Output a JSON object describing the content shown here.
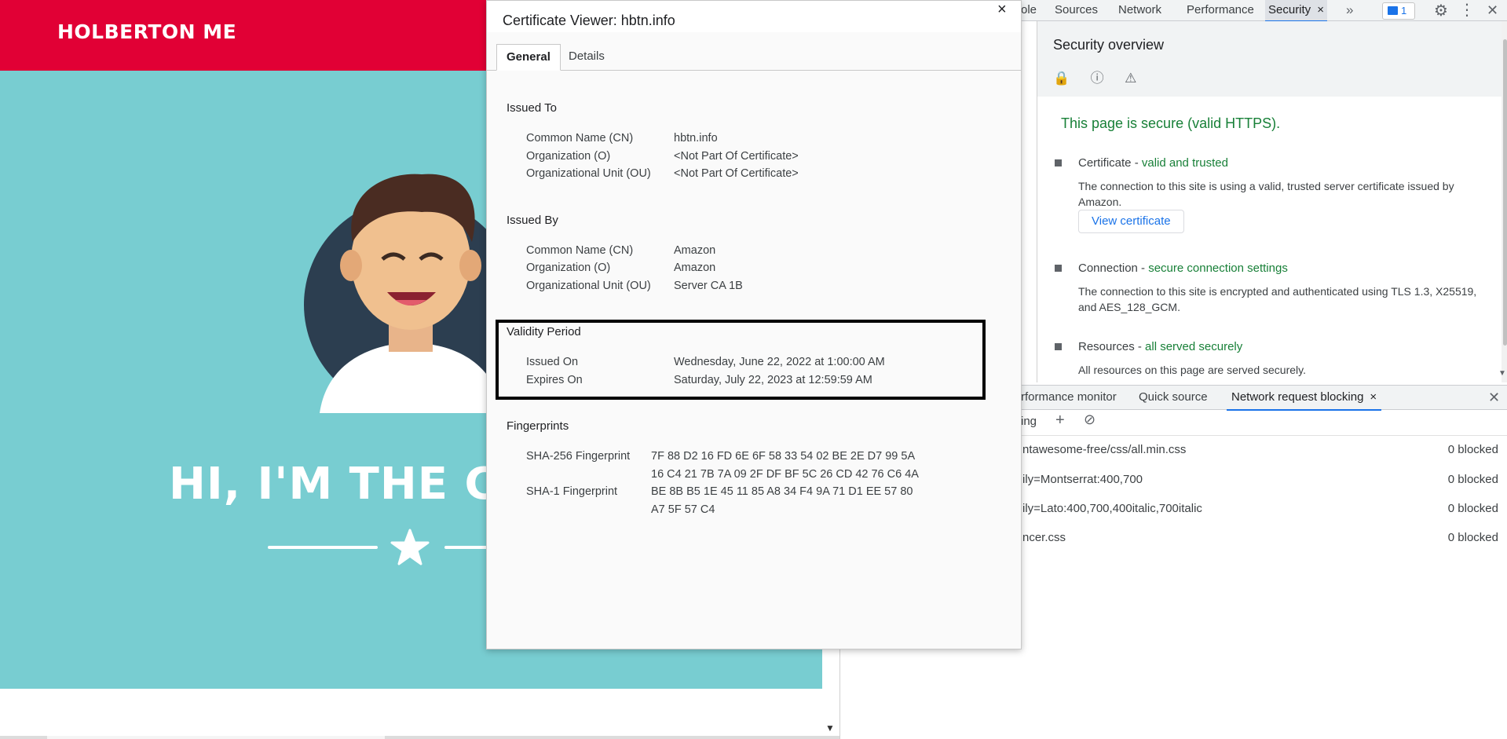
{
  "site": {
    "title": "HOLBERTON ME",
    "hero_heading": "HI, I'M THE CH"
  },
  "colors": {
    "header_bg": "#e10035",
    "hero_bg": "#78cdd1",
    "secure_green": "#188038",
    "link_blue": "#1a73e8"
  },
  "devtools": {
    "tabs": [
      {
        "label": "ole"
      },
      {
        "label": "Sources"
      },
      {
        "label": "Network"
      },
      {
        "label": "Performance"
      },
      {
        "label": "Security"
      }
    ],
    "close_tab_glyph": "×",
    "more_glyph": "»",
    "issues_count": "1",
    "security": {
      "title": "Security overview",
      "secure_message": "This page is secure (valid HTTPS).",
      "items": [
        {
          "label": "Certificate - ",
          "status": "valid and trusted",
          "description": "The connection to this site is using a valid, trusted server certificate issued by Amazon.",
          "button": "View certificate"
        },
        {
          "label": "Connection - ",
          "status": "secure connection settings",
          "description": "The connection to this site is encrypted and authenticated using TLS 1.3, X25519, and AES_128_GCM."
        },
        {
          "label": "Resources - ",
          "status": "all served securely",
          "description": "All resources on this page are served securely."
        }
      ]
    },
    "drawer": {
      "tabs": [
        {
          "label": "rformance monitor"
        },
        {
          "label": "Quick source"
        },
        {
          "label": "Network request blocking"
        }
      ],
      "toolbar_text": "ing",
      "rows": [
        {
          "pattern": "ntawesome-free/css/all.min.css",
          "count": "0 blocked"
        },
        {
          "pattern": "ily=Montserrat:400,700",
          "count": "0 blocked"
        },
        {
          "pattern": "ily=Lato:400,700,400italic,700italic",
          "count": "0 blocked"
        },
        {
          "pattern": "ncer.css",
          "count": "0 blocked"
        }
      ]
    }
  },
  "cert": {
    "title": "Certificate Viewer: hbtn.info",
    "close_glyph": "×",
    "tabs": {
      "general": "General",
      "details": "Details"
    },
    "issued_to": {
      "heading": "Issued To",
      "rows": [
        {
          "k": "Common Name (CN)",
          "v": "hbtn.info"
        },
        {
          "k": "Organization (O)",
          "v": "<Not Part Of Certificate>"
        },
        {
          "k": "Organizational Unit (OU)",
          "v": "<Not Part Of Certificate>"
        }
      ]
    },
    "issued_by": {
      "heading": "Issued By",
      "rows": [
        {
          "k": "Common Name (CN)",
          "v": "Amazon"
        },
        {
          "k": "Organization (O)",
          "v": "Amazon"
        },
        {
          "k": "Organizational Unit (OU)",
          "v": "Server CA 1B"
        }
      ]
    },
    "validity": {
      "heading": "Validity Period",
      "rows": [
        {
          "k": "Issued On",
          "v": "Wednesday, June 22, 2022 at 1:00:00 AM"
        },
        {
          "k": "Expires On",
          "v": "Saturday, July 22, 2023 at 12:59:59 AM"
        }
      ]
    },
    "fingerprints": {
      "heading": "Fingerprints",
      "sha256_label": "SHA-256 Fingerprint",
      "sha256_line1": "7F 88 D2 16 FD 6E 6F 58 33 54 02 BE 2E D7 99 5A",
      "sha256_line2": "16 C4 21 7B 7A 09 2F DF BF 5C 26 CD 42 76 C6 4A",
      "sha1_label": "SHA-1 Fingerprint",
      "sha1_line1": "BE 8B B5 1E 45 11 85 A8 34 F4 9A 71 D1 EE 57 80",
      "sha1_line2": "A7 5F 57 C4"
    }
  }
}
